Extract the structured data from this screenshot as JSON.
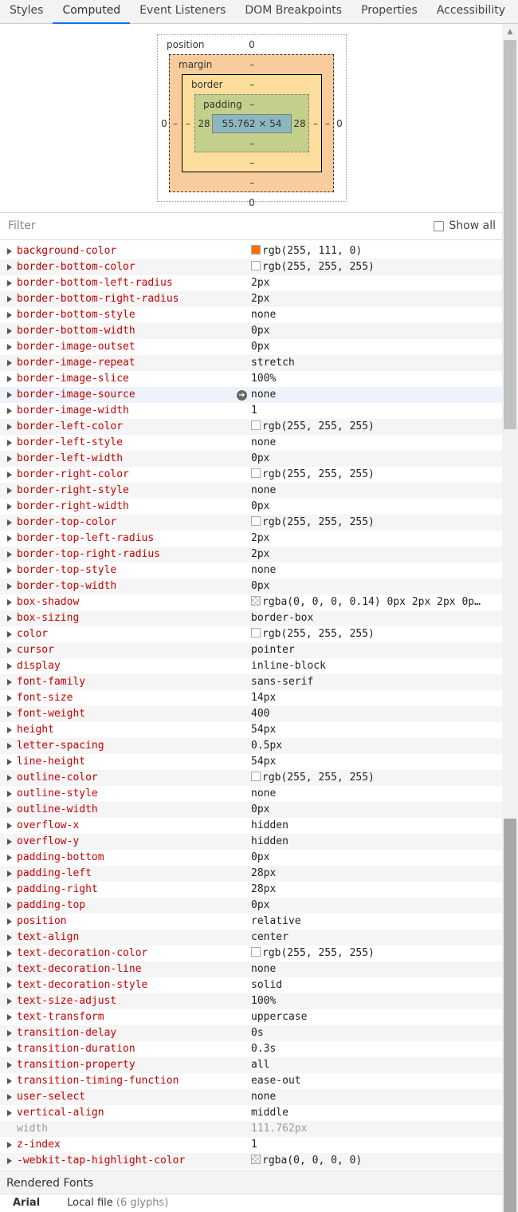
{
  "tabs": [
    {
      "label": "Styles",
      "active": false
    },
    {
      "label": "Computed",
      "active": true
    },
    {
      "label": "Event Listeners",
      "active": false
    },
    {
      "label": "DOM Breakpoints",
      "active": false
    },
    {
      "label": "Properties",
      "active": false
    },
    {
      "label": "Accessibility",
      "active": false
    }
  ],
  "box_model": {
    "position_label": "position",
    "position_top": "0",
    "position_left": "0",
    "position_right": "0",
    "position_bottom": "0",
    "margin_label": "margin",
    "margin_top": "–",
    "margin_left": "–",
    "margin_right": "–",
    "margin_bottom": "–",
    "border_label": "border",
    "border_top": "–",
    "border_left": "–",
    "border_right": "–",
    "border_bottom": "–",
    "padding_label": "padding",
    "padding_top": "–",
    "padding_left": "28",
    "padding_right": "28",
    "padding_bottom": "–",
    "content": "55.762 × 54"
  },
  "filter": {
    "placeholder": "Filter",
    "show_all_label": "Show all"
  },
  "properties": [
    {
      "name": "background-color",
      "value": "rgb(255, 111, 0)",
      "swatch": "#ff6f00"
    },
    {
      "name": "border-bottom-color",
      "value": "rgb(255, 255, 255)",
      "swatch": "#ffffff"
    },
    {
      "name": "border-bottom-left-radius",
      "value": "2px"
    },
    {
      "name": "border-bottom-right-radius",
      "value": "2px"
    },
    {
      "name": "border-bottom-style",
      "value": "none"
    },
    {
      "name": "border-bottom-width",
      "value": "0px"
    },
    {
      "name": "border-image-outset",
      "value": "0px"
    },
    {
      "name": "border-image-repeat",
      "value": "stretch"
    },
    {
      "name": "border-image-slice",
      "value": "100%"
    },
    {
      "name": "border-image-source",
      "value": "none",
      "highlight": true,
      "goto": true
    },
    {
      "name": "border-image-width",
      "value": "1"
    },
    {
      "name": "border-left-color",
      "value": "rgb(255, 255, 255)",
      "swatch": "#ffffff"
    },
    {
      "name": "border-left-style",
      "value": "none"
    },
    {
      "name": "border-left-width",
      "value": "0px"
    },
    {
      "name": "border-right-color",
      "value": "rgb(255, 255, 255)",
      "swatch": "#ffffff"
    },
    {
      "name": "border-right-style",
      "value": "none"
    },
    {
      "name": "border-right-width",
      "value": "0px"
    },
    {
      "name": "border-top-color",
      "value": "rgb(255, 255, 255)",
      "swatch": "#ffffff"
    },
    {
      "name": "border-top-left-radius",
      "value": "2px"
    },
    {
      "name": "border-top-right-radius",
      "value": "2px"
    },
    {
      "name": "border-top-style",
      "value": "none"
    },
    {
      "name": "border-top-width",
      "value": "0px"
    },
    {
      "name": "box-shadow",
      "value": "rgba(0, 0, 0, 0.14) 0px 2px 2px 0p…",
      "swatch": "checker"
    },
    {
      "name": "box-sizing",
      "value": "border-box"
    },
    {
      "name": "color",
      "value": "rgb(255, 255, 255)",
      "swatch": "#ffffff"
    },
    {
      "name": "cursor",
      "value": "pointer"
    },
    {
      "name": "display",
      "value": "inline-block"
    },
    {
      "name": "font-family",
      "value": "sans-serif"
    },
    {
      "name": "font-size",
      "value": "14px"
    },
    {
      "name": "font-weight",
      "value": "400"
    },
    {
      "name": "height",
      "value": "54px"
    },
    {
      "name": "letter-spacing",
      "value": "0.5px"
    },
    {
      "name": "line-height",
      "value": "54px"
    },
    {
      "name": "outline-color",
      "value": "rgb(255, 255, 255)",
      "swatch": "#ffffff"
    },
    {
      "name": "outline-style",
      "value": "none"
    },
    {
      "name": "outline-width",
      "value": "0px"
    },
    {
      "name": "overflow-x",
      "value": "hidden"
    },
    {
      "name": "overflow-y",
      "value": "hidden"
    },
    {
      "name": "padding-bottom",
      "value": "0px"
    },
    {
      "name": "padding-left",
      "value": "28px"
    },
    {
      "name": "padding-right",
      "value": "28px"
    },
    {
      "name": "padding-top",
      "value": "0px"
    },
    {
      "name": "position",
      "value": "relative"
    },
    {
      "name": "text-align",
      "value": "center"
    },
    {
      "name": "text-decoration-color",
      "value": "rgb(255, 255, 255)",
      "swatch": "#ffffff"
    },
    {
      "name": "text-decoration-line",
      "value": "none"
    },
    {
      "name": "text-decoration-style",
      "value": "solid"
    },
    {
      "name": "text-size-adjust",
      "value": "100%"
    },
    {
      "name": "text-transform",
      "value": "uppercase"
    },
    {
      "name": "transition-delay",
      "value": "0s"
    },
    {
      "name": "transition-duration",
      "value": "0.3s"
    },
    {
      "name": "transition-property",
      "value": "all"
    },
    {
      "name": "transition-timing-function",
      "value": "ease-out"
    },
    {
      "name": "user-select",
      "value": "none"
    },
    {
      "name": "vertical-align",
      "value": "middle"
    },
    {
      "name": "width",
      "value": "111.762px",
      "inactive": true
    },
    {
      "name": "z-index",
      "value": "1"
    },
    {
      "name": "-webkit-tap-highlight-color",
      "value": "rgba(0, 0, 0, 0)",
      "swatch": "checker"
    }
  ],
  "rendered_fonts": {
    "header": "Rendered Fonts",
    "font_name": "Arial",
    "font_source": "Local file",
    "font_glyphs": "(6 glyphs)"
  },
  "goto_glyph": "➔"
}
